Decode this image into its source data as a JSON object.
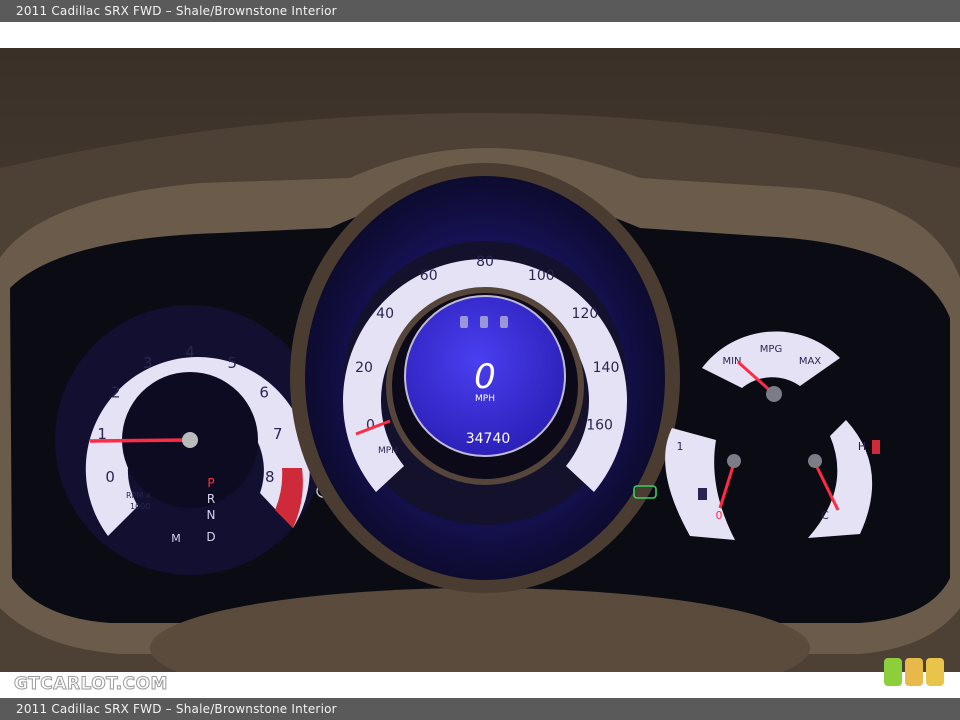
{
  "header": {
    "caption": "2011 Cadillac SRX FWD – Shale/Brownstone Interior"
  },
  "footer": {
    "caption": "2011 Cadillac SRX FWD – Shale/Brownstone Interior",
    "watermark": "GTCARLOT.COM"
  },
  "cluster": {
    "tachometer": {
      "ticks": [
        "0",
        "1",
        "2",
        "3",
        "4",
        "5",
        "6",
        "7",
        "8"
      ],
      "unit_line1": "RPM x",
      "unit_line2": "1000",
      "gears": [
        "P",
        "R",
        "N",
        "D"
      ],
      "manual": "M",
      "reading_rpm_x1000": 1
    },
    "speedometer": {
      "ticks": [
        "0",
        "20",
        "40",
        "60",
        "80",
        "100",
        "120",
        "140",
        "160"
      ],
      "unit": "MPH",
      "digital_speed": "0",
      "digital_unit": "MPH",
      "odometer": "34740",
      "reading_mph": 0
    },
    "mpg_gauge": {
      "min": "MIN",
      "label": "MPG",
      "max": "MAX"
    },
    "fuel_gauge": {
      "full": "1",
      "empty": "0"
    },
    "temp_gauge": {
      "hot": "H",
      "cold": "C"
    }
  },
  "colors": {
    "gauge_face": "#e6e2f6",
    "needle": "#ff2a44",
    "lcd": "#3c2fe0",
    "bezel": "#7a6a58"
  },
  "badge_colors": [
    "#8ccf3a",
    "#e8b84a",
    "#e8c44a"
  ]
}
